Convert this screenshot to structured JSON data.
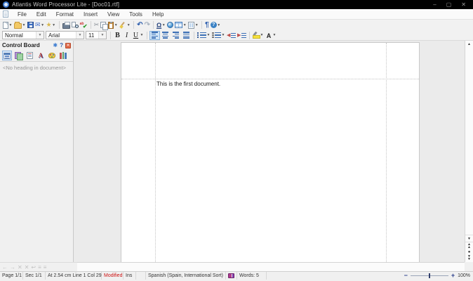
{
  "window": {
    "title": "Atlantis Word Processor Lite - [Doc01.rtf]",
    "controls": {
      "minimize": "–",
      "maximize": "▢",
      "close": "✕"
    }
  },
  "menu": {
    "items": [
      "File",
      "Edit",
      "Format",
      "Insert",
      "View",
      "Tools",
      "Help"
    ]
  },
  "formatting": {
    "style_value": "Normal",
    "font_value": "Arial",
    "size_value": "11",
    "bold_label": "B",
    "italic_label": "I",
    "underline_label": "U"
  },
  "control_board": {
    "title": "Control Board",
    "help_label": "?",
    "empty_message": "<No heading in document>"
  },
  "document": {
    "text": "This is the first document."
  },
  "status_bar": {
    "page": "Page 1/1",
    "section": "Sec 1/1",
    "position": "At 2.54 cm  Line 1  Col 29",
    "modified": "Modified",
    "insert_mode": "Ins",
    "language": "Spanish (Spain, International Sort)",
    "words": "Words: 5",
    "zoom_value": "100%",
    "zoom_out": "−",
    "zoom_in": "+"
  },
  "colors": {
    "accent": "#3b6fb5",
    "modified_text": "#cc1111",
    "title_bar": "#000000",
    "highlight_yellow": "#f5e13d",
    "font_color_red": "#d03a2b"
  }
}
